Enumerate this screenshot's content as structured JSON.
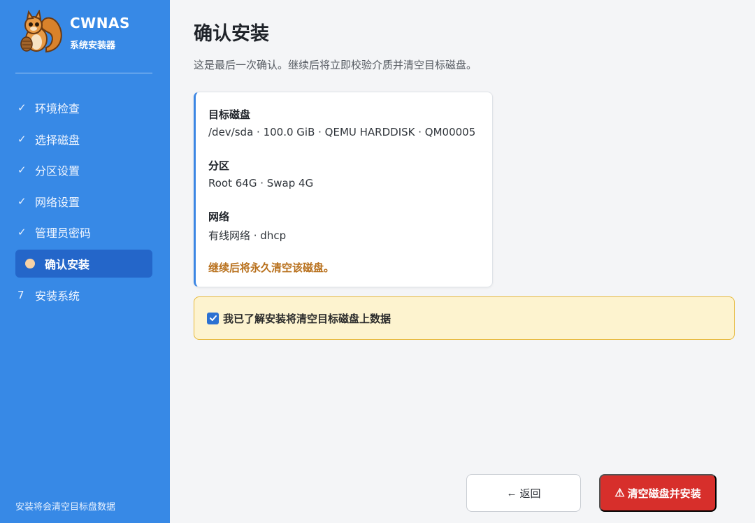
{
  "brand": {
    "title": "CWNAS",
    "subtitle": "系统安装器"
  },
  "steps": [
    {
      "label": "环境检查",
      "status": "done",
      "mark": "✓"
    },
    {
      "label": "选择磁盘",
      "status": "done",
      "mark": "✓"
    },
    {
      "label": "分区设置",
      "status": "done",
      "mark": "✓"
    },
    {
      "label": "网络设置",
      "status": "done",
      "mark": "✓"
    },
    {
      "label": "管理员密码",
      "status": "done",
      "mark": "✓"
    },
    {
      "label": "确认安装",
      "status": "active",
      "mark": ""
    },
    {
      "label": "安装系统",
      "status": "pending",
      "mark": "7"
    }
  ],
  "sidebar_footer": "安装将会清空目标盘数据",
  "page": {
    "title": "确认安装",
    "subtitle": "这是最后一次确认。继续后将立即校验介质并清空目标磁盘。"
  },
  "summary": {
    "disk_label": "目标磁盘",
    "disk_value": "/dev/sda · 100.0 GiB · QEMU HARDDISK · QM00005",
    "partition_label": "分区",
    "partition_value": "Root 64G · Swap 4G",
    "network_label": "网络",
    "network_value": "有线网络 · dhcp",
    "warning": "继续后将永久清空该磁盘。"
  },
  "confirm": {
    "label": "我已了解安装将清空目标磁盘上数据",
    "checked": true
  },
  "buttons": {
    "back_label": "返回",
    "install_label": "清空磁盘并安装"
  },
  "colors": {
    "sidebar": "#3789e6",
    "active_step": "#2466c9",
    "danger": "#d72f2b",
    "warning_text": "#b8701c",
    "confirm_bg": "#fdf3cf"
  }
}
